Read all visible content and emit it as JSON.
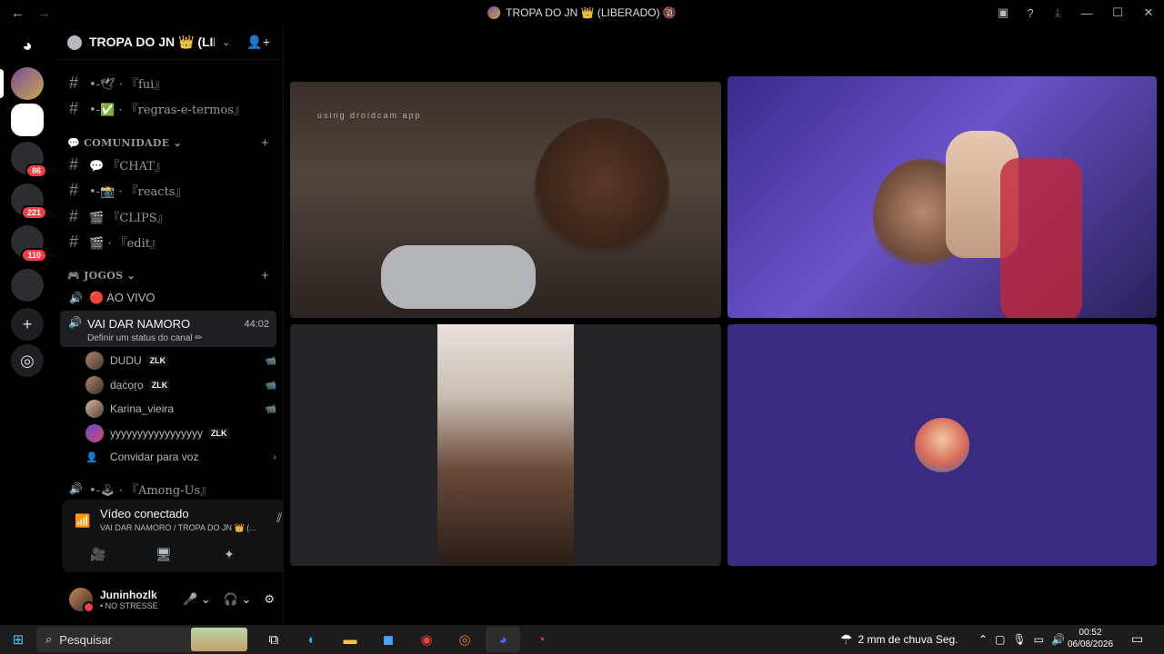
{
  "titlebar": {
    "title": "TROPA DO JN 👑 (LIBERADO) 🔞",
    "back": "←",
    "forward": "→",
    "icons": [
      "inbox-icon",
      "help-icon",
      "download-icon"
    ],
    "min": "—",
    "max": "☐",
    "close": "✕"
  },
  "rail": {
    "badges": [
      "86",
      "221",
      "110"
    ]
  },
  "server": {
    "name": "TROPA DO JN 👑 (LIBER...",
    "chevron": "⌄",
    "add_user": "👤+"
  },
  "channels_top": [
    {
      "label": "•-🕊 · 『fui』"
    },
    {
      "label": "•-✅ · 『regras-e-termos』"
    }
  ],
  "categories": [
    {
      "label": "💬 COMUNIDADE ⌄",
      "plus": "+"
    },
    {
      "label": "🎮 JOGOS ⌄",
      "plus": "+"
    }
  ],
  "channels_comunidade": [
    {
      "label": "💬 『CHAT』"
    },
    {
      "label": "•-📸 · 『reacts』"
    },
    {
      "label": "🎬 『CLIPS』"
    },
    {
      "label": "🎬 · 『edit』"
    }
  ],
  "voice": {
    "ao_vivo": "🔴 AO VIVO",
    "active_name": "VAI DAR NAMORO",
    "active_time": "44:02",
    "active_status": "Definir um status do canal ✏",
    "invite": "Convidar para voz",
    "among": "•-🕹 · 『Among-Us』"
  },
  "voice_users": [
    {
      "name": "DUDU",
      "tag": "ZLK",
      "cam": "📹"
    },
    {
      "name": "ḋạċọṟọ",
      "tag": "ZLK",
      "cam": "📹"
    },
    {
      "name": "Karina_vieira",
      "tag": "",
      "cam": "📹"
    },
    {
      "name": "yyyyyyyyyyyyyyyyy",
      "tag": "ZLK",
      "cam": ""
    }
  ],
  "vpanel": {
    "title": "Vídeo conectado",
    "subtitle": "VAI DAR NAMORO / TROPA DO JN 👑 (...",
    "btn_video": "🎥",
    "btn_share": "🖥",
    "btn_activity": "✦",
    "btn_sound": "✺"
  },
  "userbar": {
    "username": "Juninhozlk",
    "status": "• NO STRESSE",
    "mic": "🎤 ⌄",
    "headset": "🎧 ⌄",
    "settings": "⚙"
  },
  "video": {
    "droidcam_text": "using droidcam app"
  },
  "taskbar": {
    "search": "Pesquisar",
    "weather": "2 mm de chuva Seg.",
    "time": "00:52",
    "date": "06/08/2026"
  }
}
